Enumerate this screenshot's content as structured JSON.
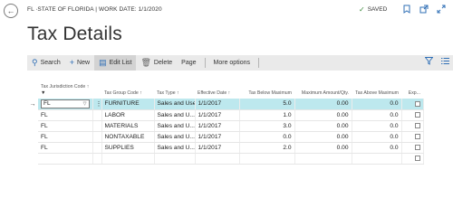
{
  "header": {
    "breadcrumb": "FL ∙STATE OF FLORIDA | WORK DATE: 1/1/2020",
    "saved_label": "SAVED",
    "title": "Tax Details"
  },
  "actions": {
    "search": "Search",
    "new": "New",
    "edit_list": "Edit List",
    "delete": "Delete",
    "page": "Page",
    "more_options": "More options"
  },
  "columns": {
    "jurisdiction": "Tax Jurisdiction Code ↑",
    "group": "Tax Group Code ↑",
    "type": "Tax Type ↑",
    "effective": "Effective Date ↑",
    "below": "Tax Below Maximum",
    "max_amount": "Maximum Amount/Qty.",
    "above": "Tax Above Maximum",
    "exp": "Exp..."
  },
  "rows": [
    {
      "jurisdiction": "FL",
      "group": "FURNITURE",
      "type": "Sales and Use Tax",
      "effective": "1/1/2017",
      "below": "5.0",
      "max_amount": "0.00",
      "above": "0.0"
    },
    {
      "jurisdiction": "FL",
      "group": "LABOR",
      "type": "Sales and U...",
      "effective": "1/1/2017",
      "below": "1.0",
      "max_amount": "0.00",
      "above": "0.0"
    },
    {
      "jurisdiction": "FL",
      "group": "MATERIALS",
      "type": "Sales and U...",
      "effective": "1/1/2017",
      "below": "3.0",
      "max_amount": "0.00",
      "above": "0.0"
    },
    {
      "jurisdiction": "FL",
      "group": "NONTAXABLE",
      "type": "Sales and U...",
      "effective": "1/1/2017",
      "below": "0.0",
      "max_amount": "0.00",
      "above": "0.0"
    },
    {
      "jurisdiction": "FL",
      "group": "SUPPLIES",
      "type": "Sales and U...",
      "effective": "1/1/2017",
      "below": "2.0",
      "max_amount": "0.00",
      "above": "0.0"
    }
  ],
  "icons": {
    "back": "arrow-left-icon",
    "saved": "checkmark-icon",
    "bookmark": "bookmark-icon",
    "open_new_window": "open-new-window-icon",
    "expand": "expand-icon",
    "search": "search-icon",
    "new": "plus-icon",
    "edit_list": "edit-list-icon",
    "delete": "trash-icon",
    "filter": "filter-icon",
    "list_view": "list-view-icon"
  },
  "colors": {
    "accent": "#2f6fb6",
    "selected_row": "#bde8ee",
    "action_bar": "#eaeaea",
    "saved_check": "#3a8a3a"
  }
}
